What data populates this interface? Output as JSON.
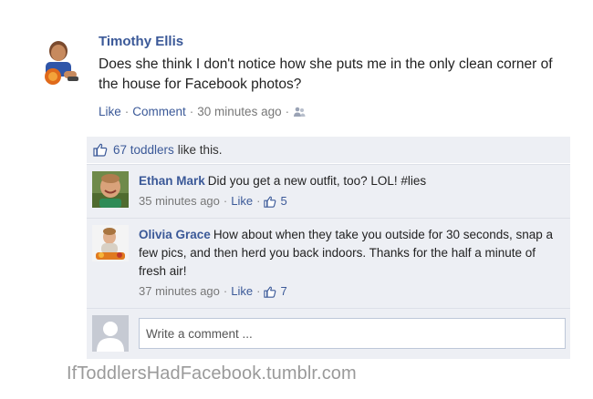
{
  "post": {
    "author": "Timothy Ellis",
    "text": "Does she think I don't notice how she puts me in the only clean corner of the house for Facebook photos?",
    "like_label": "Like",
    "comment_label": "Comment",
    "time": "30 minutes ago"
  },
  "likes": {
    "count_label": "67 toddlers",
    "suffix": "like this."
  },
  "comments": [
    {
      "name": "Ethan Mark",
      "text": "Did you get a new outfit, too? LOL! #lies",
      "time": "35 minutes ago",
      "like_label": "Like",
      "like_count": "5"
    },
    {
      "name": "Olivia Grace",
      "text": "How about when they take you outside for 30 seconds, snap a few pics, and then herd you back indoors. Thanks for the half a minute of fresh air!",
      "time": "37 minutes ago",
      "like_label": "Like",
      "like_count": "7"
    }
  ],
  "write_comment": {
    "placeholder": "Write a comment ..."
  },
  "watermark": "IfToddlersHadFacebook.tumblr.com",
  "colors": {
    "link": "#3b5998",
    "feedback_bg": "#edeff4",
    "meta_text": "#777777"
  },
  "icons": {
    "visibility": "friends-icon",
    "like": "thumbs-up-icon"
  }
}
